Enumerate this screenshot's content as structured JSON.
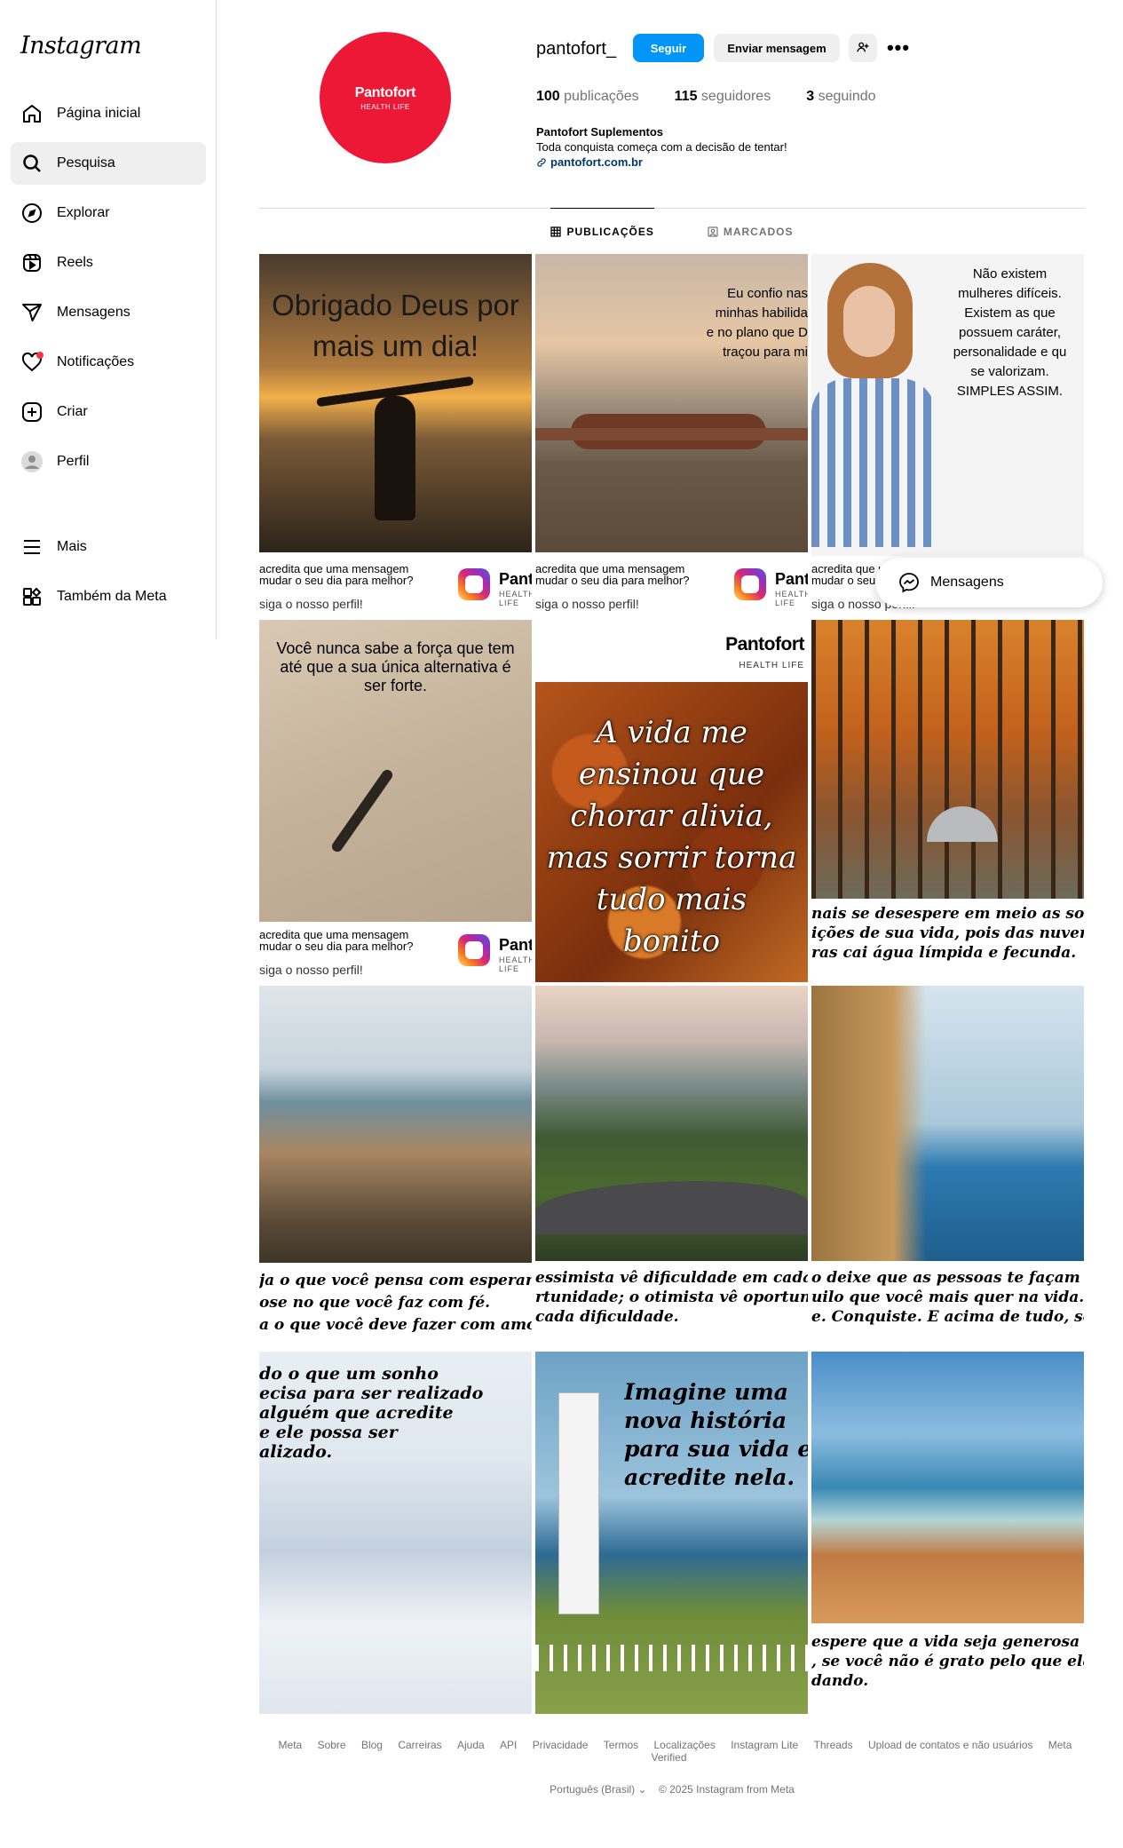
{
  "sidebar": {
    "logo": "Instagram",
    "items": [
      {
        "label": "Página inicial",
        "icon": "home-icon"
      },
      {
        "label": "Pesquisa",
        "icon": "search-icon"
      },
      {
        "label": "Explorar",
        "icon": "compass-icon"
      },
      {
        "label": "Reels",
        "icon": "reels-icon"
      },
      {
        "label": "Mensagens",
        "icon": "send-icon"
      },
      {
        "label": "Notificações",
        "icon": "heart-icon"
      },
      {
        "label": "Criar",
        "icon": "plus-square-icon"
      },
      {
        "label": "Perfil",
        "icon": "avatar-icon"
      }
    ],
    "bottom_items": [
      {
        "label": "Mais",
        "icon": "menu-icon"
      },
      {
        "label": "Também da Meta",
        "icon": "meta-apps-icon"
      }
    ]
  },
  "profile": {
    "avatar_brand": "Pantofort",
    "avatar_sub": "HEALTH LIFE",
    "username": "pantofort_",
    "follow_label": "Seguir",
    "message_label": "Enviar mensagem",
    "stats": {
      "posts": {
        "count": "100",
        "label": "publicações"
      },
      "followers": {
        "count": "115",
        "label": "seguidores"
      },
      "following": {
        "count": "3",
        "label": "seguindo"
      }
    },
    "bio_name": "Pantofort Suplementos",
    "bio_text": "Toda conquista começa com a decisão de tentar!",
    "bio_link": "pantofort.com.br"
  },
  "tabs": [
    {
      "label": "PUBLICAÇÕES",
      "icon": "grid-icon"
    },
    {
      "label": "MARCADOS",
      "icon": "tagged-icon"
    }
  ],
  "promo": {
    "line1": "acredita que uma mensagem",
    "line2": "mudar o seu dia para melhor?",
    "line3": "siga o nosso perfil!",
    "brand": "Pantofort",
    "brand_sub": "HEALTH LIFE"
  },
  "posts": {
    "p1": {
      "line1": "Obrigado Deus por",
      "line2": "mais um dia!"
    },
    "p2": {
      "lines": [
        "Eu confio nas",
        "minhas habilida",
        "e no plano que D",
        "traçou para mi"
      ]
    },
    "p3": {
      "lines": [
        "Não existem",
        "mulheres difíceis.",
        "Existem as que",
        "possuem caráter,",
        "personalidade e qu",
        "se valorizam.",
        "SIMPLES ASSIM."
      ]
    },
    "p4": {
      "lines": [
        "Você nunca sabe a força que tem",
        "até que a sua única alternativa é",
        "ser forte."
      ]
    },
    "p5": {
      "brand": "Pantofort",
      "brand_sub": "HEALTH LIFE",
      "lines": [
        "A vida me",
        "ensinou que",
        "chorar alivia,",
        "mas sorrir torna",
        "tudo mais",
        "bonito"
      ]
    },
    "p6": {
      "lines": [
        "nais se desespere em meio as sombri",
        "ições de sua vida, pois das nuvens ma",
        "ras cai água límpida e fecunda."
      ]
    },
    "p7": {
      "lines": [
        "ja o que você pensa com esperança.",
        "ose no que você faz com fé.",
        "a o que você deve fazer com amor!"
      ]
    },
    "p8": {
      "lines": [
        "essimista vê dificuldade em cada",
        "rtunidade; o otimista vê oportunida",
        "cada dificuldade."
      ]
    },
    "p9": {
      "lines": [
        "o deixe que as pessoas te façam desistir",
        "uilo que você mais quer na vida. Acred",
        "e. Conquiste. E acima de tudo, seja feliz"
      ]
    },
    "p10": {
      "lines": [
        "do o que um sonho",
        "ecisa para ser realizado",
        "alguém que acredite",
        "e ele possa ser",
        "alizado."
      ]
    },
    "p11": {
      "lines": [
        "Imagine uma",
        "nova história",
        "para sua vida e",
        "acredite nela."
      ]
    },
    "p12": {
      "lines": [
        "espere que a vida seja generosa co",
        ", se você não é grato pelo que ela já",
        "dando."
      ]
    }
  },
  "messages_pill": {
    "label": "Mensagens"
  },
  "footer": {
    "links": [
      "Meta",
      "Sobre",
      "Blog",
      "Carreiras",
      "Ajuda",
      "API",
      "Privacidade",
      "Termos",
      "Localizações",
      "Instagram Lite",
      "Threads",
      "Upload de contatos e não usuários",
      "Meta Verified"
    ],
    "language": "Português (Brasil)",
    "copyright": "© 2025 Instagram from Meta"
  },
  "colors": {
    "accent": "#0095f6",
    "brand_red": "#ed1836",
    "notification": "#ff3040"
  }
}
